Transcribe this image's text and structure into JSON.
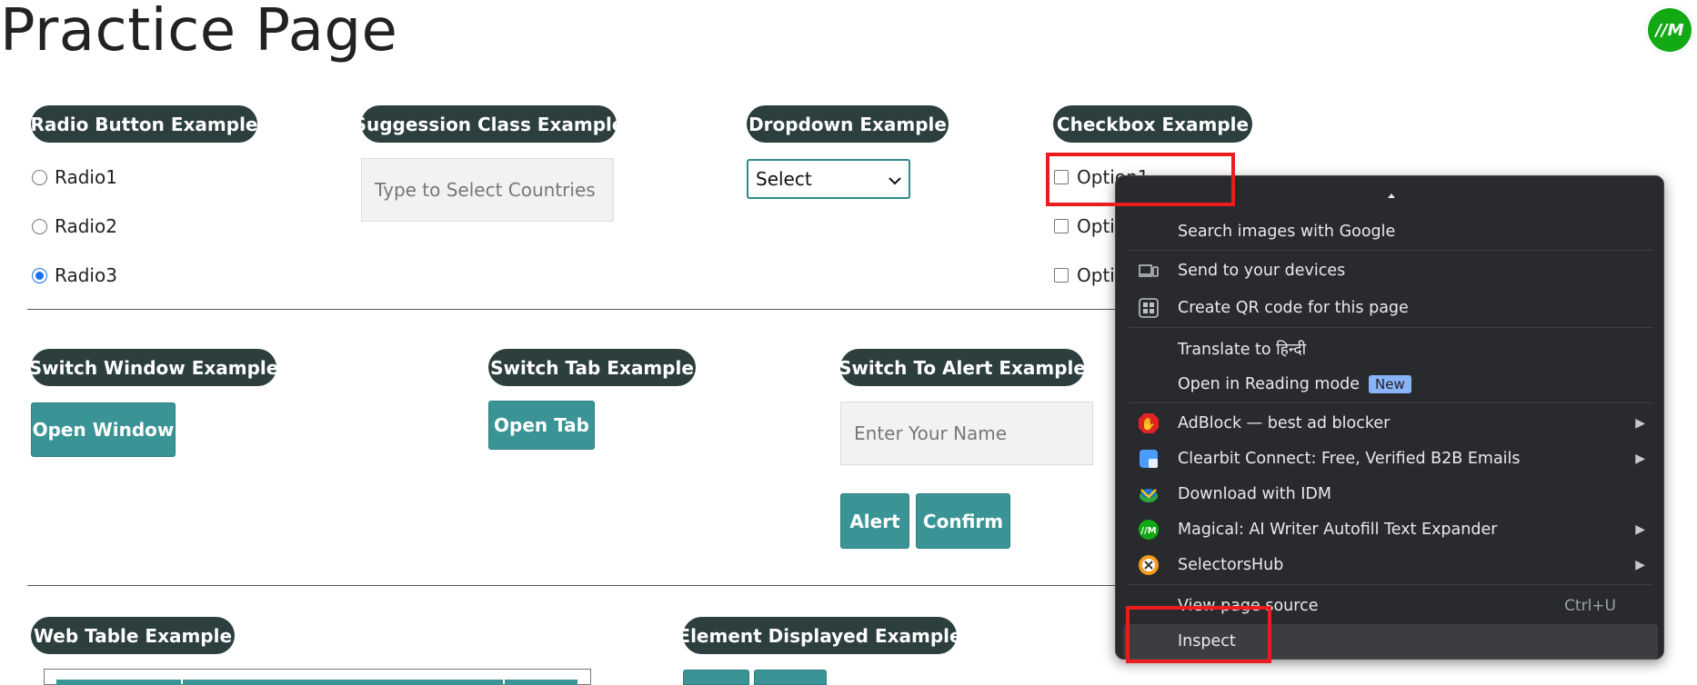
{
  "page": {
    "title": "Practice Page",
    "logo_text": "//M"
  },
  "sections": {
    "radio": {
      "legend": "Radio Button Example",
      "options": [
        "Radio1",
        "Radio2",
        "Radio3"
      ],
      "selected": "Radio3"
    },
    "suggestion": {
      "legend": "Suggession Class Example",
      "placeholder": "Type to Select Countries"
    },
    "dropdown": {
      "legend": "Dropdown Example",
      "selected_value": "Select"
    },
    "checkbox": {
      "legend": "Checkbox Example",
      "options": [
        "Option1",
        "Opti",
        "Opti"
      ]
    },
    "switch_window": {
      "legend": "Switch Window Example",
      "button_label": "Open Window"
    },
    "switch_tab": {
      "legend": "Switch Tab Example",
      "button_label": "Open Tab"
    },
    "alert": {
      "legend": "Switch To Alert Example",
      "placeholder": "Enter Your Name",
      "alert_label": "Alert",
      "confirm_label": "Confirm"
    },
    "web_table": {
      "legend": "Web Table Example"
    },
    "element_displayed": {
      "legend": "Element Displayed Example"
    }
  },
  "context_menu": {
    "items": [
      {
        "label": "Search images with Google",
        "icon": "none"
      },
      {
        "label": "Send to your devices",
        "icon": "devices-icon"
      },
      {
        "label": "Create QR code for this page",
        "icon": "qr-code-icon"
      },
      {
        "label": "Translate to हिन्दी",
        "icon": "none"
      },
      {
        "label": "Open in Reading mode",
        "icon": "none",
        "badge": "New"
      },
      {
        "label": "AdBlock — best ad blocker",
        "icon": "adblock-icon",
        "submenu": true
      },
      {
        "label": "Clearbit Connect: Free, Verified B2B Emails",
        "icon": "clearbit-icon",
        "submenu": true
      },
      {
        "label": "Download with IDM",
        "icon": "idm-icon"
      },
      {
        "label": "Magical: AI Writer  Autofill Text Expander",
        "icon": "magical-icon",
        "submenu": true
      },
      {
        "label": "SelectorsHub",
        "icon": "selectorshub-icon",
        "submenu": true
      },
      {
        "label": "View page source",
        "icon": "none",
        "shortcut": "Ctrl+U"
      },
      {
        "label": "Inspect",
        "icon": "none"
      }
    ],
    "colors": {
      "background": "#292a2d",
      "text": "#e8eaed",
      "badge": "#8ab4f8"
    }
  },
  "colors": {
    "legend_bg": "#2c3e3e",
    "button_bg": "#3a9496",
    "highlight_border": "#ec1c1c",
    "radio_checked": "#1a73e8"
  }
}
